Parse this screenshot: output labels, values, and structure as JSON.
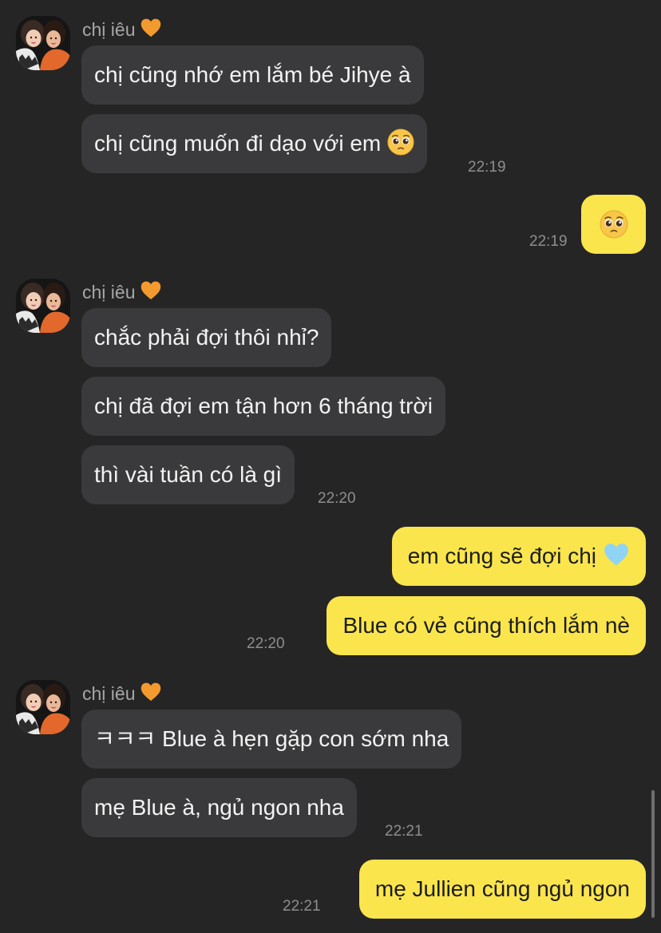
{
  "contact": {
    "name": "chị iêu",
    "name_emoji": "orange-heart-icon",
    "avatar": "couple-photo-avatar"
  },
  "messages": [
    {
      "text": "chị cũng nhớ em lắm bé Jihye à"
    },
    {
      "text": "chị cũng muốn đi dạo với em",
      "emoji": "pleading-face-icon"
    },
    {
      "time": "22:19"
    },
    {
      "emoji": "pleading-face-icon"
    },
    {
      "time": "22:19"
    },
    {
      "text": "chắc phải đợi thôi nhỉ?"
    },
    {
      "text": "chị đã đợi em tận hơn 6 tháng trời"
    },
    {
      "text": "thì vài tuần có là gì"
    },
    {
      "time": "22:20"
    },
    {
      "text": "em cũng sẽ đợi chị",
      "emoji": "light-blue-heart-icon"
    },
    {
      "text": "Blue có vẻ cũng thích lắm nè"
    },
    {
      "time": "22:20"
    },
    {
      "text": "ㅋㅋㅋ Blue à hẹn gặp con sớm nha"
    },
    {
      "text": "mẹ Blue à, ngủ ngon nha"
    },
    {
      "time": "22:21"
    },
    {
      "text": "mẹ Jullien cũng ngủ ngon"
    },
    {
      "time": "22:21"
    }
  ],
  "colors": {
    "background": "#252525",
    "incoming_bubble": "#3a3a3c",
    "outgoing_bubble": "#fae54d",
    "timestamp": "#8e8e8e"
  }
}
